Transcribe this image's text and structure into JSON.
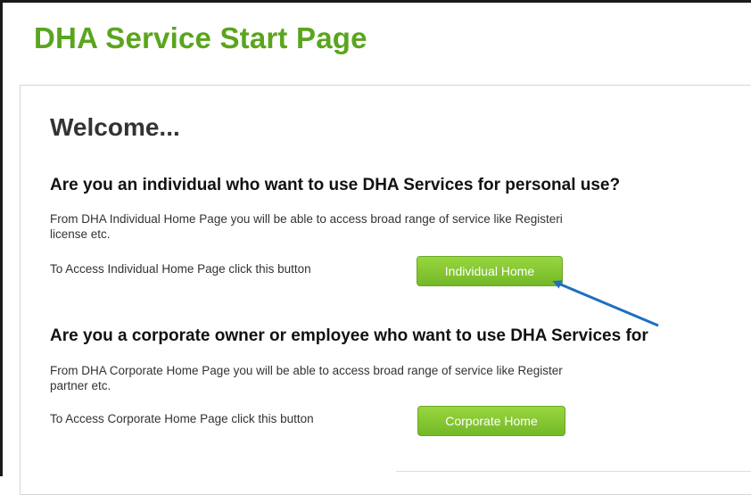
{
  "header": {
    "title": "DHA Service Start Page"
  },
  "main": {
    "welcome": "Welcome...",
    "individual": {
      "heading": "Are you an individual who want to use DHA Services for personal use?",
      "description_line1": "From DHA Individual Home Page you will be able to access broad range of service like Registeri",
      "description_line2": "license etc.",
      "access_text": "To Access Individual Home Page click this button",
      "button_label": "Individual Home"
    },
    "corporate": {
      "heading": "Are you a corporate owner or employee who want to use DHA Services for",
      "description_line1": "From DHA Corporate Home Page you will be able to access broad range of service like Register",
      "description_line2": "partner etc.",
      "access_text": "To Access Corporate Home Page click this button",
      "button_label": "Corporate Home"
    }
  },
  "colors": {
    "title_green": "#5aa51e",
    "button_green": "#7cc02e",
    "annotation_arrow": "#1f6fbf"
  },
  "icons": {
    "annotation": "arrow-pointer-icon"
  }
}
